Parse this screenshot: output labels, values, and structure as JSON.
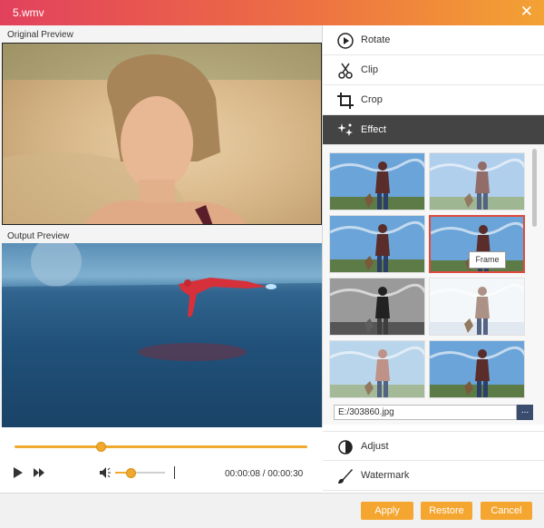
{
  "window": {
    "title": "5.wmv"
  },
  "preview": {
    "original_label": "Original Preview",
    "output_label": "Output Preview"
  },
  "player": {
    "current_time": "00:00:08",
    "separator": "/",
    "total_time": "00:00:30",
    "progress": 0.295,
    "volume": 0.3
  },
  "side_menu": {
    "rotate": "Rotate",
    "clip": "Clip",
    "crop": "Crop",
    "effect": "Effect",
    "adjust": "Adjust",
    "watermark": "Watermark"
  },
  "effects": {
    "tooltip": "Frame",
    "selected_index": 3
  },
  "watermark_path": {
    "value": "E:/303860.jpg",
    "browse_label": "..."
  },
  "footer": {
    "apply": "Apply",
    "restore": "Restore",
    "cancel": "Cancel"
  },
  "colors": {
    "accent": "#f5a630",
    "titlebar_start": "#e2415d",
    "titlebar_end": "#f3a233",
    "active_menu": "#444444"
  }
}
